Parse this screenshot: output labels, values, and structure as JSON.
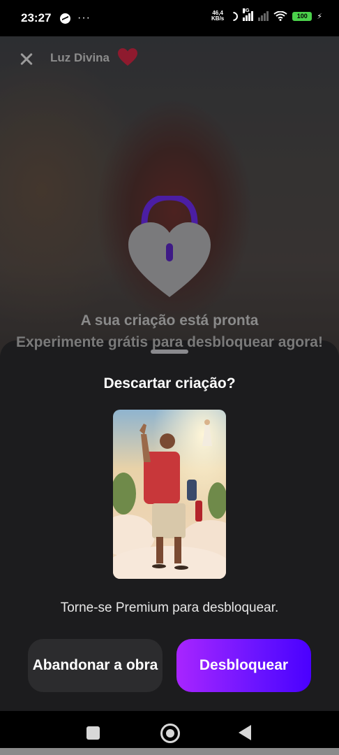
{
  "status_bar": {
    "time": "23:27",
    "more": "···",
    "net_speed_value": "46,4",
    "net_speed_unit": "KB/s",
    "network_type": "3G",
    "battery": "100"
  },
  "header": {
    "brand": "Luz Divina"
  },
  "locked_screen": {
    "title": "A sua criação está pronta",
    "subtitle": "Experimente grátis para desbloquear agora!"
  },
  "sheet": {
    "title": "Descartar criação?",
    "message": "Torne-se Premium para desbloquear.",
    "abandon_label": "Abandonar a obra",
    "unlock_label": "Desbloquear"
  },
  "colors": {
    "accent_purple": "#a825ff",
    "accent_blue": "#4a00ff",
    "sheet_bg": "#1c1c1e",
    "heart_red": "#9e1830"
  },
  "icons": {
    "close": "close-icon",
    "brand_heart": "heart-icon",
    "lock": "heart-lock-icon",
    "nav_recents": "square-icon",
    "nav_home": "circle-icon",
    "nav_back": "back-triangle-icon"
  }
}
